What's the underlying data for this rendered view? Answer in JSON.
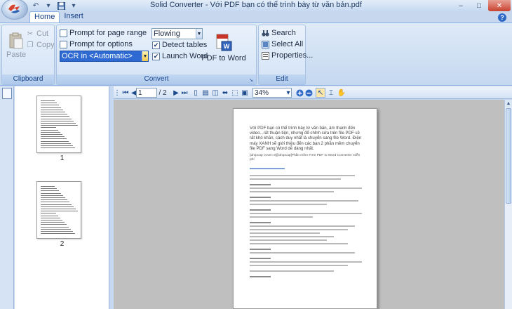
{
  "window": {
    "title": "Solid Converter - Với PDF bạn có thể trình bày từ văn bản.pdf",
    "controls": {
      "minimize": "–",
      "maximize": "□",
      "close": "✕"
    }
  },
  "qat": {
    "icons": [
      "undo-icon",
      "dropdown-icon",
      "save-icon",
      "dropdown-icon"
    ]
  },
  "tabs": [
    {
      "label": "Home",
      "active": true
    },
    {
      "label": "Insert",
      "active": false
    }
  ],
  "help": {
    "label": "?"
  },
  "ribbon": {
    "clipboard": {
      "label": "Clipboard",
      "paste": "Paste",
      "cut": "Cut",
      "copy": "Copy"
    },
    "convert": {
      "label": "Convert",
      "prompt_page_range": {
        "label": "Prompt for page range",
        "checked": false
      },
      "prompt_options": {
        "label": "Prompt for options",
        "checked": false
      },
      "flowing": {
        "value": "Flowing"
      },
      "ocr": {
        "value": "OCR in <Automatic>"
      },
      "detect_tables": {
        "label": "Detect tables",
        "checked": true
      },
      "launch_word": {
        "label": "Launch Word",
        "checked": true
      },
      "pdf_to_word": "PDF to Word"
    },
    "edit": {
      "label": "Edit",
      "search": "Search",
      "select_all": "Select All",
      "properties": "Properties..."
    }
  },
  "thumbnails": [
    {
      "label": "1"
    },
    {
      "label": "2"
    }
  ],
  "viewer_toolbar": {
    "current_page": "1",
    "total_pages": "/ 2",
    "zoom": "34%"
  },
  "document": {
    "intro": "Với PDF bạn có thể trình bày từ văn bản, âm thanh đến video...rất thuận tiện, nhưng để chỉnh sửa trên file PDF sẽ rất khó khăn, cách duy nhất là chuyển sang file Word. Điện máy XANH sẽ giới thiệu đến các bạn 2 phần mềm chuyển file PDF sang Word dễ dàng nhất.",
    "shortcode": "[dropcap cover=0][/dropcap]Phần mềm Free PDF to Word Converter miễn phí"
  },
  "colors": {
    "ribbon_bg": "#dfeaf7",
    "accent_blue": "#2e6ad1",
    "viewer_bg": "#bfbfbf"
  }
}
